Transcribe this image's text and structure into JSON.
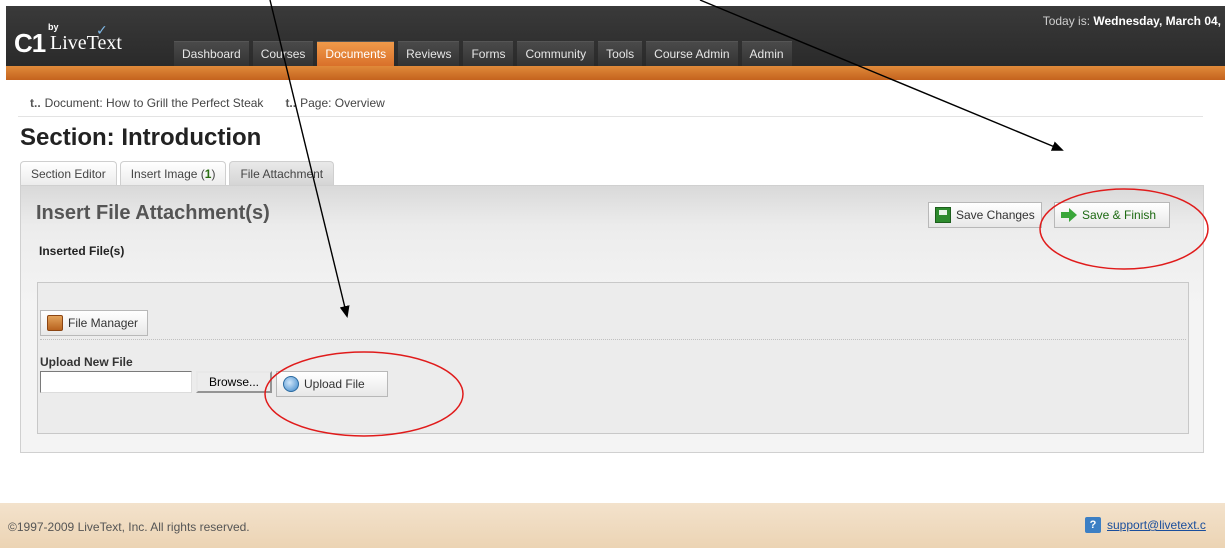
{
  "app": {
    "logo_by": "by",
    "logo_name": "LiveText",
    "today_label": "Today is:",
    "today_value": "Wednesday, March 04,"
  },
  "nav": {
    "items": [
      {
        "label": "Dashboard"
      },
      {
        "label": "Courses"
      },
      {
        "label": "Documents"
      },
      {
        "label": "Reviews"
      },
      {
        "label": "Forms"
      },
      {
        "label": "Community"
      },
      {
        "label": "Tools"
      },
      {
        "label": "Course Admin"
      },
      {
        "label": "Admin"
      }
    ],
    "active": "Documents"
  },
  "breadcrumb": {
    "items": [
      {
        "label": "Document: How to Grill the Perfect Steak"
      },
      {
        "label": "Page: Overview"
      }
    ]
  },
  "page": {
    "title": "Section: Introduction"
  },
  "tabs": {
    "section_editor": "Section Editor",
    "insert_image": "Insert Image (",
    "insert_image_count": "1",
    "insert_image_close": ")",
    "file_attachment": "File Attachment",
    "active": "File Attachment"
  },
  "panel": {
    "title": "Insert File Attachment(s)",
    "inserted_files_label": "Inserted File(s)",
    "save_changes": "Save Changes",
    "save_finish": "Save & Finish",
    "file_manager": "File Manager",
    "upload_new_file_label": "Upload New File",
    "file_input_value": "",
    "browse": "Browse...",
    "upload_file": "Upload File"
  },
  "footer": {
    "copyright": "©1997-2009 LiveText, Inc. All rights reserved.",
    "support_email": "support@livetext.c"
  },
  "colors": {
    "header_dark": "#2e2e2e",
    "header_orange": "#d9702a",
    "nav_active": "#e8843a",
    "footer_bg": "#efdbbf",
    "annotation_red": "#e01b1b"
  }
}
